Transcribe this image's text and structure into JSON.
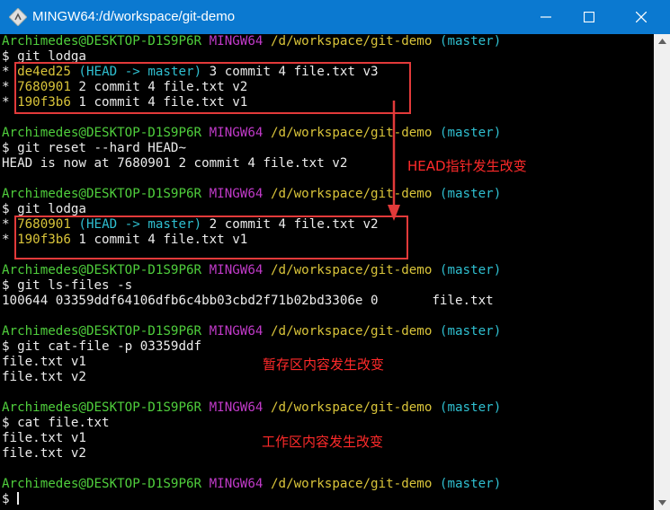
{
  "window": {
    "title": "MINGW64:/d/workspace/git-demo"
  },
  "prompt": {
    "user": "Archimedes@DESKTOP-D1S9P6R",
    "shell": "MINGW64",
    "path": "/d/workspace/git-demo",
    "branch": "(master)"
  },
  "lines": {
    "cmd1": "$ git lodga",
    "log1_1": {
      "star": "* ",
      "hash": "de4ed25",
      "refs_open": " (",
      "head": "HEAD -> master",
      "refs_close": ")",
      "msg": " 3 commit 4 file.txt v3"
    },
    "log1_2": {
      "star": "* ",
      "hash": "7680901",
      "msg": " 2 commit 4 file.txt v2"
    },
    "log1_3": {
      "star": "* ",
      "hash": "190f3b6",
      "msg": " 1 commit 4 file.txt v1"
    },
    "cmd2": "$ git reset --hard HEAD~",
    "out2": "HEAD is now at 7680901 2 commit 4 file.txt v2",
    "cmd3": "$ git lodga",
    "log2_1": {
      "star": "* ",
      "hash": "7680901",
      "refs_open": " (",
      "head": "HEAD -> master",
      "refs_close": ")",
      "msg": " 2 commit 4 file.txt v2"
    },
    "log2_2": {
      "star": "* ",
      "hash": "190f3b6",
      "msg": " 1 commit 4 file.txt v1"
    },
    "cmd4": "$ git ls-files -s",
    "out4": "100644 03359ddf64106dfb6c4bb03cbd2f71b02bd3306e 0       file.txt",
    "cmd5": "$ git cat-file -p 03359ddf",
    "out5_1": "file.txt v1",
    "out5_2": "file.txt v2",
    "cmd6": "$ cat file.txt",
    "out6_1": "file.txt v1",
    "out6_2": "file.txt v2",
    "cmd7": "$ "
  },
  "annotations": {
    "head_changed": "HEAD指针发生改变",
    "index_changed": "暂存区内容发生改变",
    "worktree_changed": "工作区内容发生改变"
  },
  "colors": {
    "titlebar": "#0b79d0",
    "user": "#4fce3c",
    "shell": "#c03ac8",
    "path": "#d9c43a",
    "branch": "#2fbfd0",
    "annotation": "#e23a3a"
  }
}
